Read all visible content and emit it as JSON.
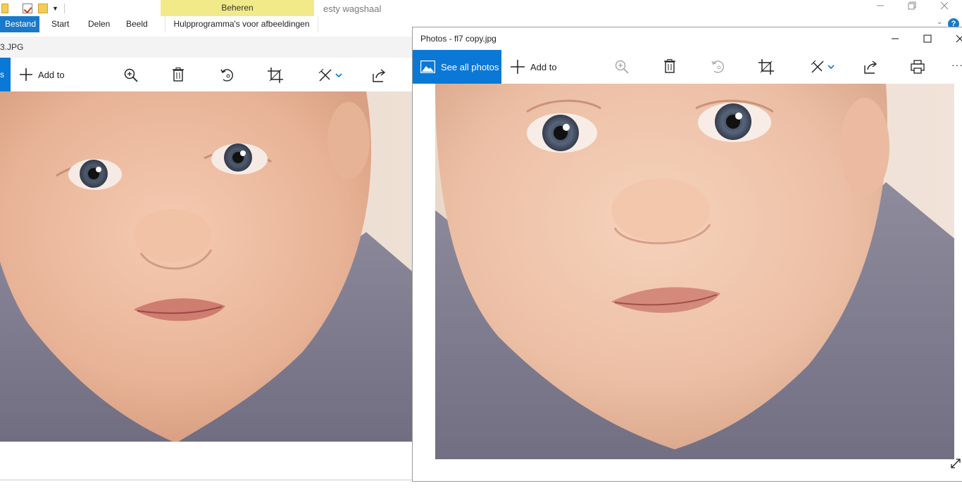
{
  "explorer": {
    "manage_tab": "Beheren",
    "window_title": "esty wagshaal",
    "tabs": [
      "Bestand",
      "Start",
      "Delen",
      "Beeld",
      "Hulpprogramma's voor afbeeldingen"
    ],
    "help_label": "?"
  },
  "left_window": {
    "title": "3.JPG",
    "stub_label": "s",
    "toolbar": {
      "add_to": "Add to"
    }
  },
  "right_window": {
    "title": "Photos - fl7 copy.jpg",
    "toolbar": {
      "see_all_photos": "See all photos",
      "add_to": "Add to",
      "more": "···"
    }
  },
  "colors": {
    "accent": "#0a78d7",
    "manage_tab": "#f2ea89",
    "file_tab": "#1979ca"
  },
  "icons": [
    "zoom-in-icon",
    "delete-icon",
    "rotate-icon",
    "crop-icon",
    "edit-icon",
    "share-icon",
    "print-icon",
    "more-icon",
    "expand-icon"
  ]
}
